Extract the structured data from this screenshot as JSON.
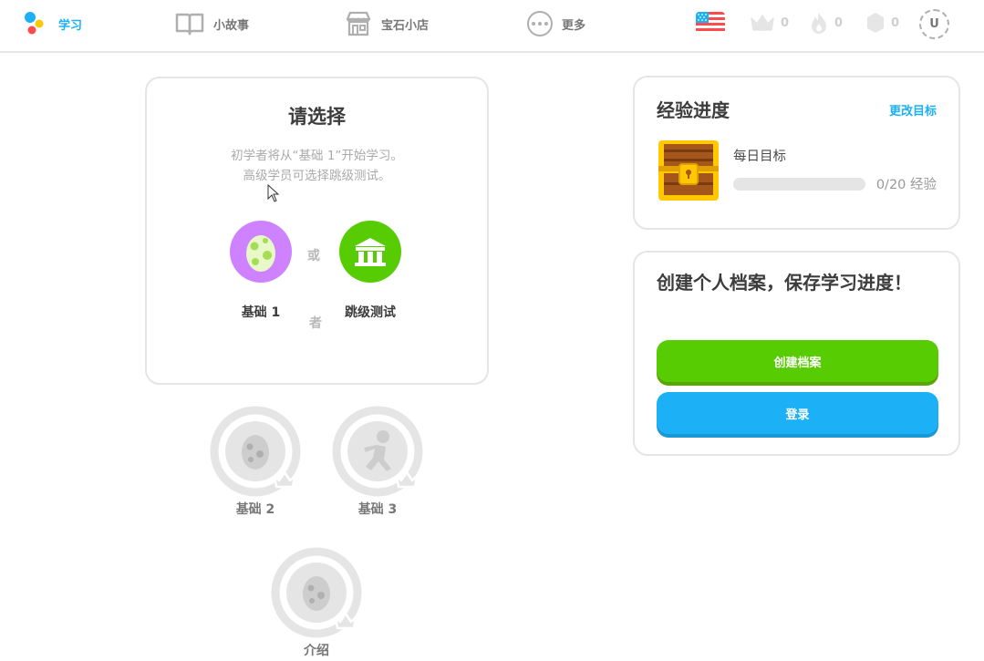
{
  "nav": {
    "learn": "学习",
    "stories": "小故事",
    "shop": "宝石小店",
    "more": "更多"
  },
  "stats": {
    "crowns": "0",
    "streak": "0",
    "gems": "0",
    "avatar_initial": "U"
  },
  "placement": {
    "title": "请选择",
    "desc_line1": "初学者将从“基础 1”开始学习。",
    "desc_line2": "高级学员可选择跳级测试。",
    "or_1": "或",
    "or_2": "者",
    "basics_label": "基础 1",
    "test_label": "跳级测试"
  },
  "skills": {
    "basics2": "基础 2",
    "basics3": "基础 3",
    "intro": "介绍"
  },
  "xp": {
    "title": "经验进度",
    "edit_goal": "更改目标",
    "daily_goal": "每日目标",
    "progress": "0/20 经验",
    "fraction": 0
  },
  "profile": {
    "title": "创建个人档案，保存学习进度！",
    "create_button": "创建档案",
    "login_button": "登录"
  },
  "colors": {
    "accent_blue": "#1cb0f6",
    "accent_green": "#58cc02",
    "egg_purple": "#ce82ff",
    "locked_gray": "#e5e5e5"
  },
  "icons": {
    "learn": "duolingo-dots-icon",
    "stories": "book-icon",
    "shop": "shop-icon",
    "more": "more-dots-icon",
    "language": "us-flag-icon",
    "crowns": "crown-icon",
    "streak": "flame-icon",
    "gems": "gem-icon",
    "basics": "egg-icon",
    "test": "castle-icon",
    "xp": "treasure-chest-icon"
  }
}
